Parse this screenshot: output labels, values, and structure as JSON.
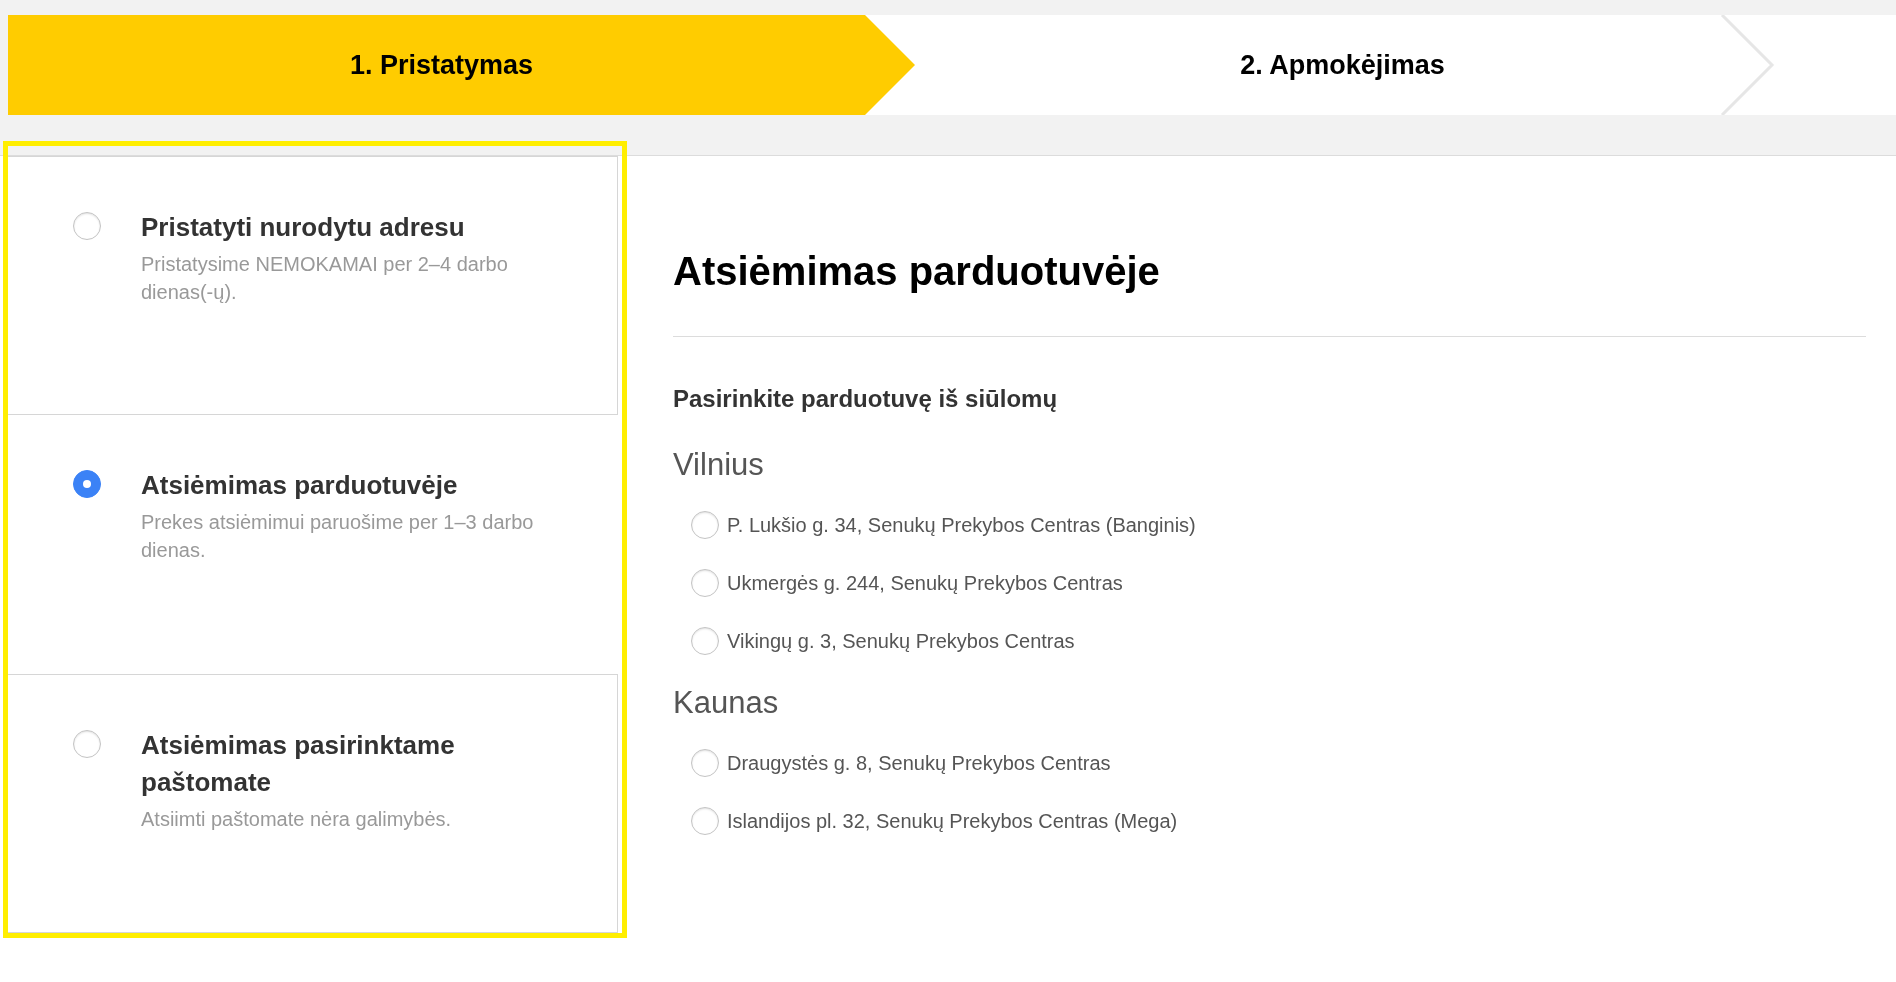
{
  "steps": [
    {
      "label": "1. Pristatymas",
      "selected": true
    },
    {
      "label": "2. Apmokėjimas",
      "selected": false
    }
  ],
  "delivery_options": [
    {
      "title": "Pristatyti nurodytu adresu",
      "description": "Pristatysime NEMOKAMAI per 2–4 darbo dienas(-ų).",
      "selected": false
    },
    {
      "title": "Atsiėmimas parduotuvėje",
      "description": "Prekes atsiėmimui paruošime per 1–3 darbo dienas.",
      "selected": true
    },
    {
      "title": "Atsiėmimas pasirinktame paštomate",
      "description": "Atsiimti paštomate nėra galimybės.",
      "selected": false
    }
  ],
  "heading": "Atsiėmimas parduotuvėje",
  "subheading": "Pasirinkite parduotuvę iš siūlomų",
  "cities": [
    {
      "name": "Vilnius",
      "stores": [
        {
          "label": "P. Lukšio g. 34, Senukų Prekybos Centras (Banginis)",
          "selected": false
        },
        {
          "label": "Ukmergės g. 244, Senukų Prekybos Centras",
          "selected": false
        },
        {
          "label": "Vikingų g. 3, Senukų Prekybos Centras",
          "selected": false
        }
      ]
    },
    {
      "name": "Kaunas",
      "stores": [
        {
          "label": "Draugystės g. 8, Senukų Prekybos Centras",
          "selected": false
        },
        {
          "label": "Islandijos pl. 32, Senukų Prekybos Centras (Mega)",
          "selected": false
        }
      ]
    }
  ]
}
